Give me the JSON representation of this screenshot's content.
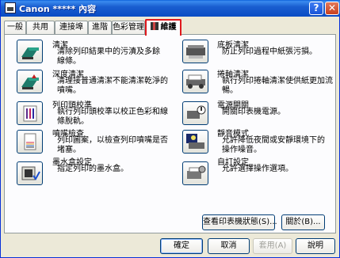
{
  "window": {
    "title": "Canon ***** 內容",
    "help_glyph": "?",
    "close_glyph": "✕"
  },
  "tabs": [
    {
      "label": "一般"
    },
    {
      "label": "共用"
    },
    {
      "label": "連接埠"
    },
    {
      "label": "進階"
    },
    {
      "label": "色彩管理"
    },
    {
      "label": "維護",
      "active": true
    }
  ],
  "left_items": [
    {
      "title": "清潔",
      "desc": "清除列印結果中的污漬及多餘線條。",
      "icon": "cleaning-icon"
    },
    {
      "title": "深度清潔",
      "desc": "清理接普通清潔不能清潔乾淨的噴嘴。",
      "icon": "deep-cleaning-icon"
    },
    {
      "title": "列印頭校準",
      "desc": "執行列印頭校準以校正色彩和線條脫軌。",
      "icon": "print-head-alignment-icon"
    },
    {
      "title": "噴嘴檢查",
      "desc": "列印圖案，以檢查列印噴嘴是否堵塞。",
      "icon": "nozzle-check-icon"
    },
    {
      "title": "墨水盒設定",
      "desc": "指定列印的墨水盒。",
      "icon": "ink-cartridge-icon"
    }
  ],
  "right_items": [
    {
      "title": "底板清潔",
      "desc": "防止列印過程中紙張污損。",
      "icon": "bottom-plate-cleaning-icon"
    },
    {
      "title": "捲軸清潔",
      "desc": "執行列印捲軸清潔使供紙更加流暢。",
      "icon": "roller-cleaning-icon"
    },
    {
      "title": "電源開關",
      "desc": "開關印表機電源。",
      "icon": "power-icon"
    },
    {
      "title": "靜音模式",
      "desc": "允許降低夜間或安靜環境下的操作噪音。",
      "icon": "quiet-mode-icon"
    },
    {
      "title": "自訂設定",
      "desc": "允許選擇操作選項。",
      "icon": "custom-settings-icon"
    }
  ],
  "panel_buttons": {
    "view_status": "查看印表機狀態(S)...",
    "about": "關於(B)..."
  },
  "dialog_buttons": {
    "ok": "確定",
    "cancel": "取消",
    "apply": "套用(A)",
    "help": "說明"
  },
  "colors": {
    "titlebar": "#0a4cc4",
    "active_tab_border": "#e0181d",
    "button_border": "#003c74"
  }
}
